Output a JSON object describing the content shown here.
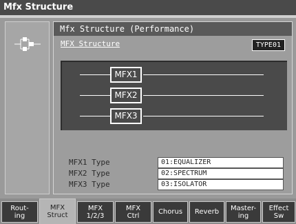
{
  "window": {
    "title": "Mfx Structure"
  },
  "left_panel": {
    "icon": "structure-icon"
  },
  "panel": {
    "header": "Mfx Structure (Performance)",
    "section_label": "MFX Structure",
    "type_badge": "TYPE01"
  },
  "diagram": {
    "blocks": [
      {
        "label": "MFX1"
      },
      {
        "label": "MFX2"
      },
      {
        "label": "MFX3"
      }
    ]
  },
  "types": [
    {
      "label": "MFX1 Type",
      "value": "01:EQUALIZER"
    },
    {
      "label": "MFX2 Type",
      "value": "02:SPECTRUM"
    },
    {
      "label": "MFX3 Type",
      "value": "03:ISOLATOR"
    }
  ],
  "tabs": [
    {
      "label": "Rout-\ning",
      "active": false
    },
    {
      "label": "MFX\nStruct",
      "active": true
    },
    {
      "label": "MFX\n1/2/3",
      "active": false
    },
    {
      "label": "MFX\nCtrl",
      "active": false
    },
    {
      "label": "Chorus",
      "active": false
    },
    {
      "label": "Reverb",
      "active": false
    },
    {
      "label": "Master-\ning",
      "active": false
    },
    {
      "label": "Effect\nSw",
      "active": false
    }
  ],
  "colors": {
    "background": "#9a9a9a",
    "title_bar": "#4a4a4a",
    "diagram_bg": "#4a4a4a",
    "active_tab": "#b5b5b5"
  }
}
